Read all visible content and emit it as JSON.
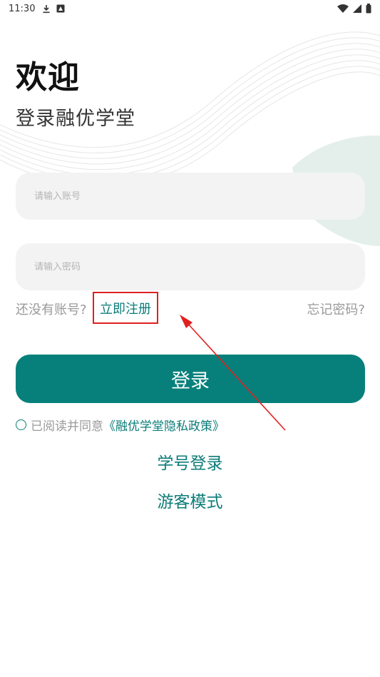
{
  "status_bar": {
    "time": "11:30",
    "icons_left": [
      "download-icon",
      "image-icon"
    ],
    "icons_right": [
      "wifi-icon",
      "signal-icon",
      "battery-icon"
    ]
  },
  "header": {
    "welcome": "欢迎",
    "subtitle": "登录融优学堂"
  },
  "form": {
    "account_placeholder": "请输入账号",
    "password_placeholder": "请输入密码"
  },
  "links": {
    "no_account": "还没有账号?",
    "register": "立即注册",
    "forgot": "忘记密码?"
  },
  "login_button": "登录",
  "agreement": {
    "text": "已阅读并同意",
    "policy": "《融优学堂隐私政策》"
  },
  "alt_logins": {
    "student_id": "学号登录",
    "guest": "游客模式"
  },
  "colors": {
    "primary": "#07807b",
    "annotation": "#e02020"
  }
}
